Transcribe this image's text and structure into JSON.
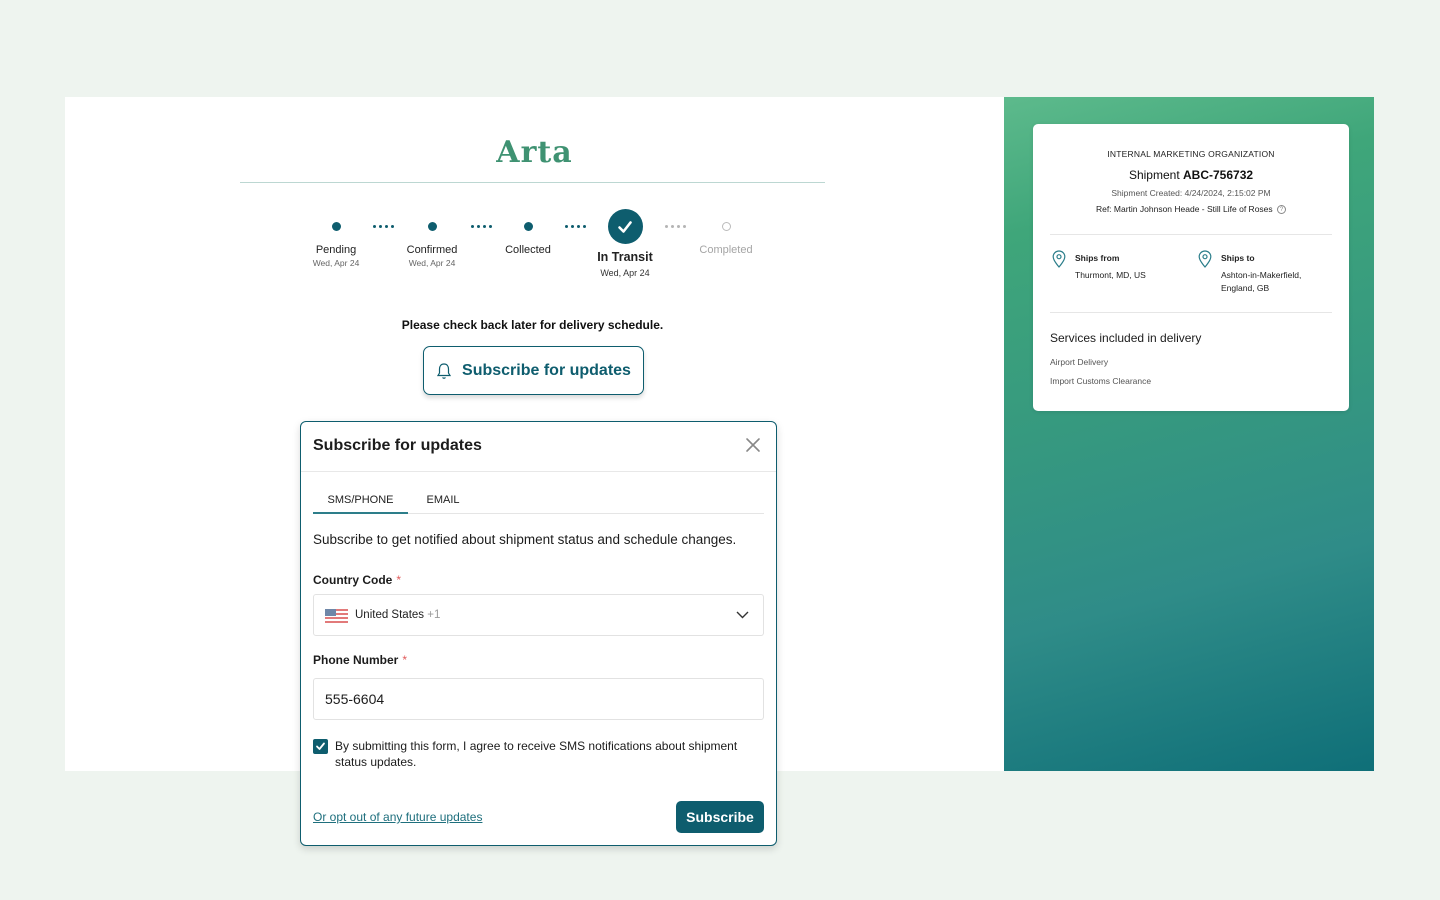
{
  "brand": {
    "logo": "Arta",
    "accent": "#0e5d6e",
    "logo_color": "#3f9272"
  },
  "tracker": {
    "steps": [
      {
        "label": "Pending",
        "date": "Wed, Apr 24",
        "state": "done"
      },
      {
        "label": "Confirmed",
        "date": "Wed, Apr 24",
        "state": "done"
      },
      {
        "label": "Collected",
        "date": "",
        "state": "done"
      },
      {
        "label": "In Transit",
        "date": "Wed, Apr 24",
        "state": "current"
      },
      {
        "label": "Completed",
        "date": "",
        "state": "pending"
      }
    ],
    "schedule_note": "Please check back later for delivery schedule.",
    "subscribe_button": "Subscribe for updates"
  },
  "modal": {
    "title": "Subscribe for updates",
    "tabs": [
      {
        "label": "SMS/PHONE",
        "active": true
      },
      {
        "label": "EMAIL",
        "active": false
      }
    ],
    "description": "Subscribe to get notified about shipment status and schedule changes.",
    "country_code": {
      "label": "Country Code",
      "required_mark": "*",
      "country": "United States",
      "dial_code": "+1"
    },
    "phone_number": {
      "label": "Phone Number",
      "required_mark": "*",
      "value": "555-6604"
    },
    "consent": {
      "checked": true,
      "text": "By submitting this form, I agree to receive SMS notifications about shipment status updates."
    },
    "opt_out_link": "Or opt out of any future updates",
    "submit_label": "Subscribe"
  },
  "shipment": {
    "organization": "INTERNAL MARKETING ORGANIZATION",
    "title_prefix": "Shipment",
    "id": "ABC-756732",
    "created": "Shipment Created: 4/24/2024, 2:15:02 PM",
    "ref": "Ref: Martin Johnson Heade - Still Life of Roses",
    "ships_from": {
      "label": "Ships from",
      "location": "Thurmont, MD, US"
    },
    "ships_to": {
      "label": "Ships to",
      "line1": "Ashton-in-Makerfield,",
      "line2": "England, GB"
    },
    "services_title": "Services included in delivery",
    "services": [
      "Airport Delivery",
      "Import Customs Clearance"
    ]
  }
}
